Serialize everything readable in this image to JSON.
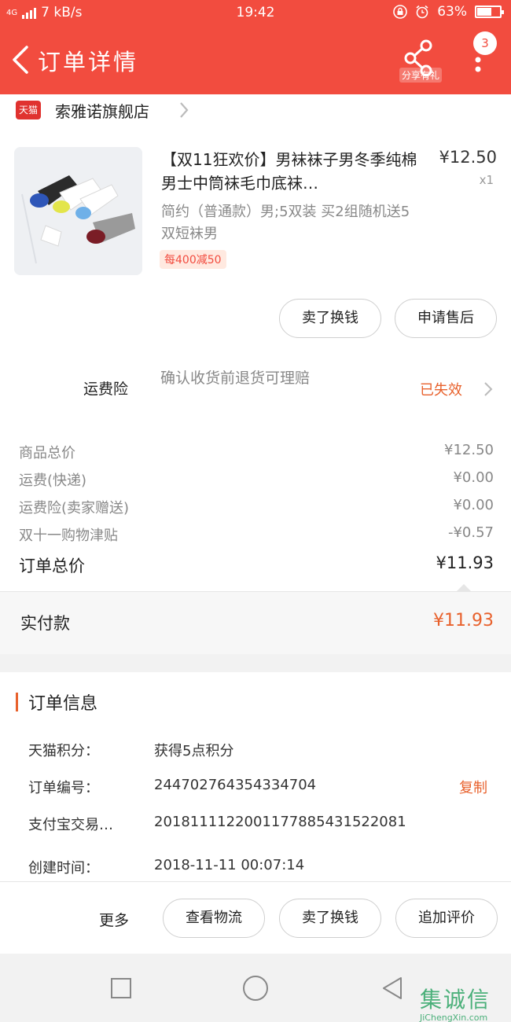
{
  "status_bar": {
    "network": "4G",
    "speed": "7 kB/s",
    "time": "19:42",
    "battery": "63%",
    "battery_level": 0.63
  },
  "header": {
    "title": "订单详情",
    "share_label": "分享有礼",
    "badge_count": "3"
  },
  "shop": {
    "logo_text": "天猫",
    "name": "索雅诺旗舰店"
  },
  "product": {
    "title": "【双11狂欢价】男袜袜子男冬季纯棉男士中筒袜毛巾底袜…",
    "price": "¥12.50",
    "qty": "x1",
    "spec": "简约（普通款）男;5双装 买2组随机送5双短袜男",
    "promo": "每400减50",
    "actions": [
      "卖了换钱",
      "申请售后"
    ]
  },
  "insurance": {
    "label": "运费险",
    "desc": "确认收货前退货可理赔",
    "status": "已失效"
  },
  "summary": [
    {
      "label": "商品总价",
      "value": "¥12.50"
    },
    {
      "label": "运费(快递)",
      "value": "¥0.00"
    },
    {
      "label": "运费险(卖家赠送)",
      "value": "¥0.00"
    },
    {
      "label": "双十一购物津贴",
      "value": "-¥0.57"
    }
  ],
  "total": {
    "label": "订单总价",
    "value": "¥11.93"
  },
  "payment": {
    "label": "实付款",
    "value": "¥11.93"
  },
  "order_info": {
    "title": "订单信息",
    "rows": [
      {
        "label": "天猫积分：",
        "value": "获得5点积分"
      },
      {
        "label": "订单编号：",
        "value": "244702764354334704",
        "action": "复制"
      },
      {
        "label": "支付宝交易…",
        "value": "2018111122001177885431522081"
      },
      {
        "label": "创建时间：",
        "value": "2018-11-11 00:07:14"
      }
    ]
  },
  "bottom_actions": {
    "more": "更多",
    "buttons": [
      "查看物流",
      "卖了换钱",
      "追加评价"
    ]
  },
  "watermark": {
    "main": "集诚信",
    "sub": "JiChengXin.com"
  },
  "colors": {
    "header_bg": "#f24c3f",
    "accent": "#e8612c"
  }
}
